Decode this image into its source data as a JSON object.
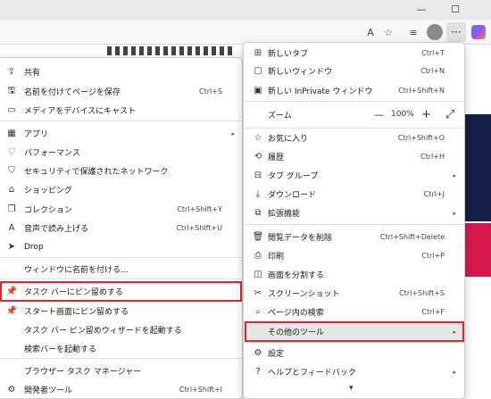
{
  "colors": {
    "highlight": "#e0262f",
    "selected_bg": "#e6e6e6"
  },
  "toolbar": {
    "icons": [
      "read-aloud-icon",
      "favorite-star-icon",
      "favorites-list-icon",
      "profile-avatar",
      "more-icon",
      "copilot-icon"
    ],
    "read_aloud_glyph": "A",
    "favorite_glyph": "☆",
    "favorites_list_glyph": "≡",
    "more_glyph": "···",
    "minimize_glyph": "—",
    "maximize_glyph": "☐"
  },
  "submenu": {
    "items": [
      {
        "label": "共有",
        "shortcut": "",
        "icon": "share-icon",
        "glyph": "⇪"
      },
      {
        "label": "名前を付けてページを保存",
        "shortcut": "Ctrl+S",
        "icon": "save-page-icon",
        "glyph": "🖫"
      },
      {
        "label": "メディアをデバイスにキャスト",
        "shortcut": "",
        "icon": "cast-icon",
        "glyph": "▭"
      },
      {
        "label": "アプリ",
        "shortcut": "",
        "icon": "apps-icon",
        "glyph": "▦",
        "arrow": "▸"
      },
      {
        "label": "パフォーマンス",
        "shortcut": "",
        "icon": "performance-icon",
        "glyph": "♡"
      },
      {
        "label": "セキュリティで保護されたネットワーク",
        "shortcut": "",
        "icon": "secure-network-icon",
        "glyph": "⛉"
      },
      {
        "label": "ショッピング",
        "shortcut": "",
        "icon": "shopping-icon",
        "glyph": "⌂"
      },
      {
        "label": "コレクション",
        "shortcut": "Ctrl+Shift+Y",
        "icon": "collections-icon",
        "glyph": "❐"
      },
      {
        "label": "音声で読み上げる",
        "shortcut": "Ctrl+Shift+U",
        "icon": "read-aloud-icon",
        "glyph": "A"
      },
      {
        "label": "Drop",
        "shortcut": "",
        "icon": "drop-icon",
        "glyph": "➤"
      },
      {
        "label": "ウィンドウに名前を付ける...",
        "shortcut": "",
        "icon": "",
        "glyph": ""
      },
      {
        "label": "タスク バーにピン留めする",
        "shortcut": "",
        "icon": "pin-icon",
        "glyph": "📌"
      },
      {
        "label": "スタート画面にピン留めする",
        "shortcut": "",
        "icon": "pin-start-icon",
        "glyph": "📌"
      },
      {
        "label": "タスク バー ピン留めウィザードを起動する",
        "shortcut": "",
        "icon": "",
        "glyph": ""
      },
      {
        "label": "検索バーを起動する",
        "shortcut": "",
        "icon": "",
        "glyph": ""
      },
      {
        "label": "ブラウザー タスク マネージャー",
        "shortcut": "",
        "icon": "",
        "glyph": ""
      },
      {
        "label": "開発者ツール",
        "shortcut": "Ctrl+Shift+I",
        "icon": "developer-tools-icon",
        "glyph": "⚙"
      }
    ]
  },
  "mainmenu": {
    "items": [
      {
        "label": "新しいタブ",
        "shortcut": "Ctrl+T",
        "icon": "new-tab-icon",
        "glyph": "⊞"
      },
      {
        "label": "新しいウィンドウ",
        "shortcut": "Ctrl+N",
        "icon": "new-window-icon",
        "glyph": "▢"
      },
      {
        "label": "新しい InPrivate ウィンドウ",
        "shortcut": "Ctrl+Shift+N",
        "icon": "inprivate-icon",
        "glyph": "▣"
      },
      {
        "label": "お気に入り",
        "shortcut": "Ctrl+Shift+O",
        "icon": "favorites-icon",
        "glyph": "☆"
      },
      {
        "label": "履歴",
        "shortcut": "Ctrl+H",
        "icon": "history-icon",
        "glyph": "⟲"
      },
      {
        "label": "タブ グループ",
        "shortcut": "",
        "icon": "tab-groups-icon",
        "glyph": "⊟",
        "arrow": "▸"
      },
      {
        "label": "ダウンロード",
        "shortcut": "Ctrl+J",
        "icon": "download-icon",
        "glyph": "⤓"
      },
      {
        "label": "拡張機能",
        "shortcut": "",
        "icon": "extensions-icon",
        "glyph": "⧉",
        "arrow": "▸"
      },
      {
        "label": "閲覧データを削除",
        "shortcut": "Ctrl+Shift+Delete",
        "icon": "delete-data-icon",
        "glyph": "🗑"
      },
      {
        "label": "印刷",
        "shortcut": "Ctrl+P",
        "icon": "print-icon",
        "glyph": "⎙"
      },
      {
        "label": "画面を分割する",
        "shortcut": "",
        "icon": "split-screen-icon",
        "glyph": "◫"
      },
      {
        "label": "スクリーンショット",
        "shortcut": "Ctrl+Shift+S",
        "icon": "screenshot-icon",
        "glyph": "✂"
      },
      {
        "label": "ページ内の検索",
        "shortcut": "Ctrl+F",
        "icon": "find-in-page-icon",
        "glyph": "⌕"
      },
      {
        "label": "その他のツール",
        "shortcut": "",
        "icon": "",
        "glyph": "",
        "arrow": "▸"
      },
      {
        "label": "設定",
        "shortcut": "",
        "icon": "settings-icon",
        "glyph": "⚙"
      },
      {
        "label": "ヘルプとフィードバック",
        "shortcut": "",
        "icon": "help-icon",
        "glyph": "?",
        "arrow": "▸"
      }
    ],
    "zoom": {
      "label": "ズーム",
      "minus": "—",
      "value": "100%",
      "plus": "+",
      "fullscreen_glyph": "⤢"
    },
    "more_glyph": "▾"
  }
}
